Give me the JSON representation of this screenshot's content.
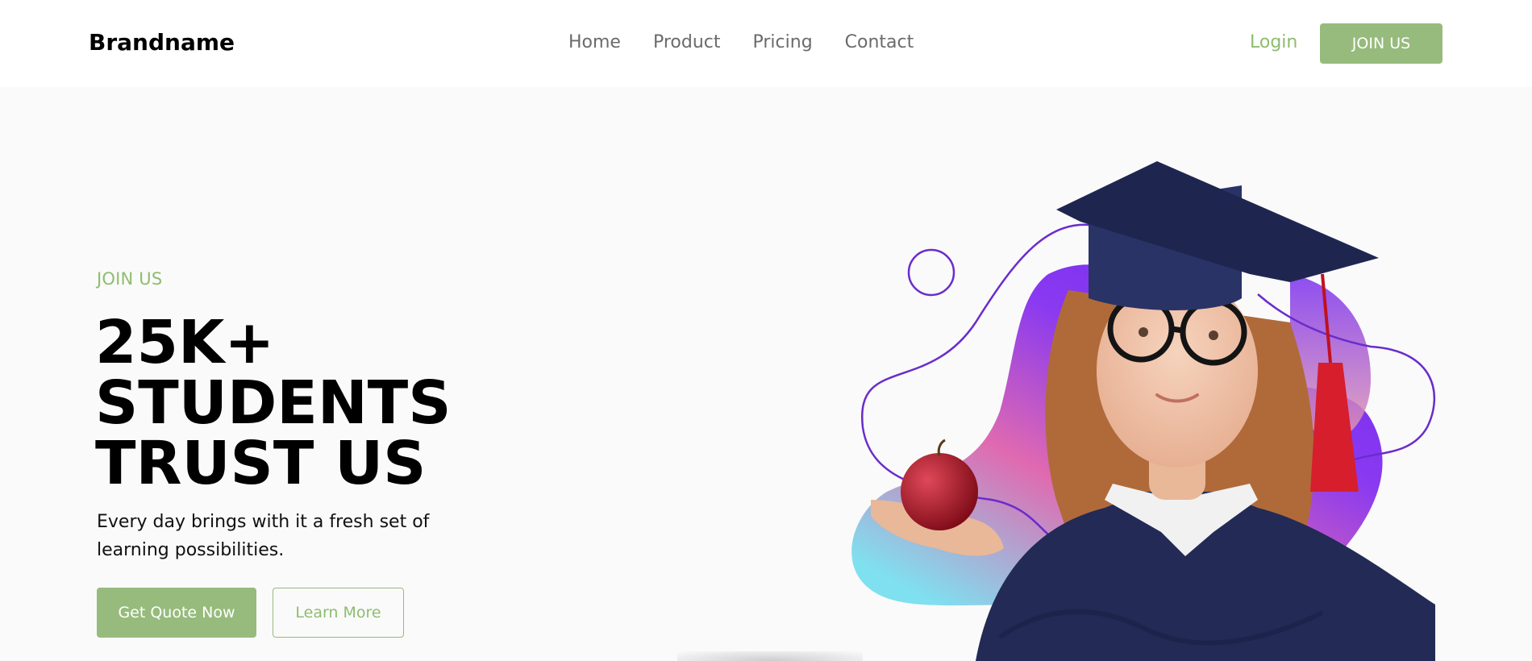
{
  "header": {
    "brand": "Brandname",
    "nav": [
      "Home",
      "Product",
      "Pricing",
      "Contact"
    ],
    "login_label": "Login",
    "join_label": "JOIN US"
  },
  "hero": {
    "eyebrow": "JOIN US",
    "headline": [
      "25K+",
      "STUDENTS",
      "TRUST US"
    ],
    "description": "Every day brings with it a fresh set of learning possibilities.",
    "primary_cta": "Get Quote Now",
    "secondary_cta": "Learn More",
    "image_subject": "girl-graduate-with-apple"
  },
  "colors": {
    "accent": "#96bb7c",
    "accent_text": "#8ebd6e",
    "nav_text": "#6b6b6b",
    "background": "#fafafa",
    "header_bg": "#ffffff",
    "blob_purple": "#7a2ff0",
    "blob_pink": "#e06ab0",
    "blob_cyan": "#7fe0f0",
    "outline_purple": "#6a2ccc",
    "gown_navy": "#222a55"
  }
}
